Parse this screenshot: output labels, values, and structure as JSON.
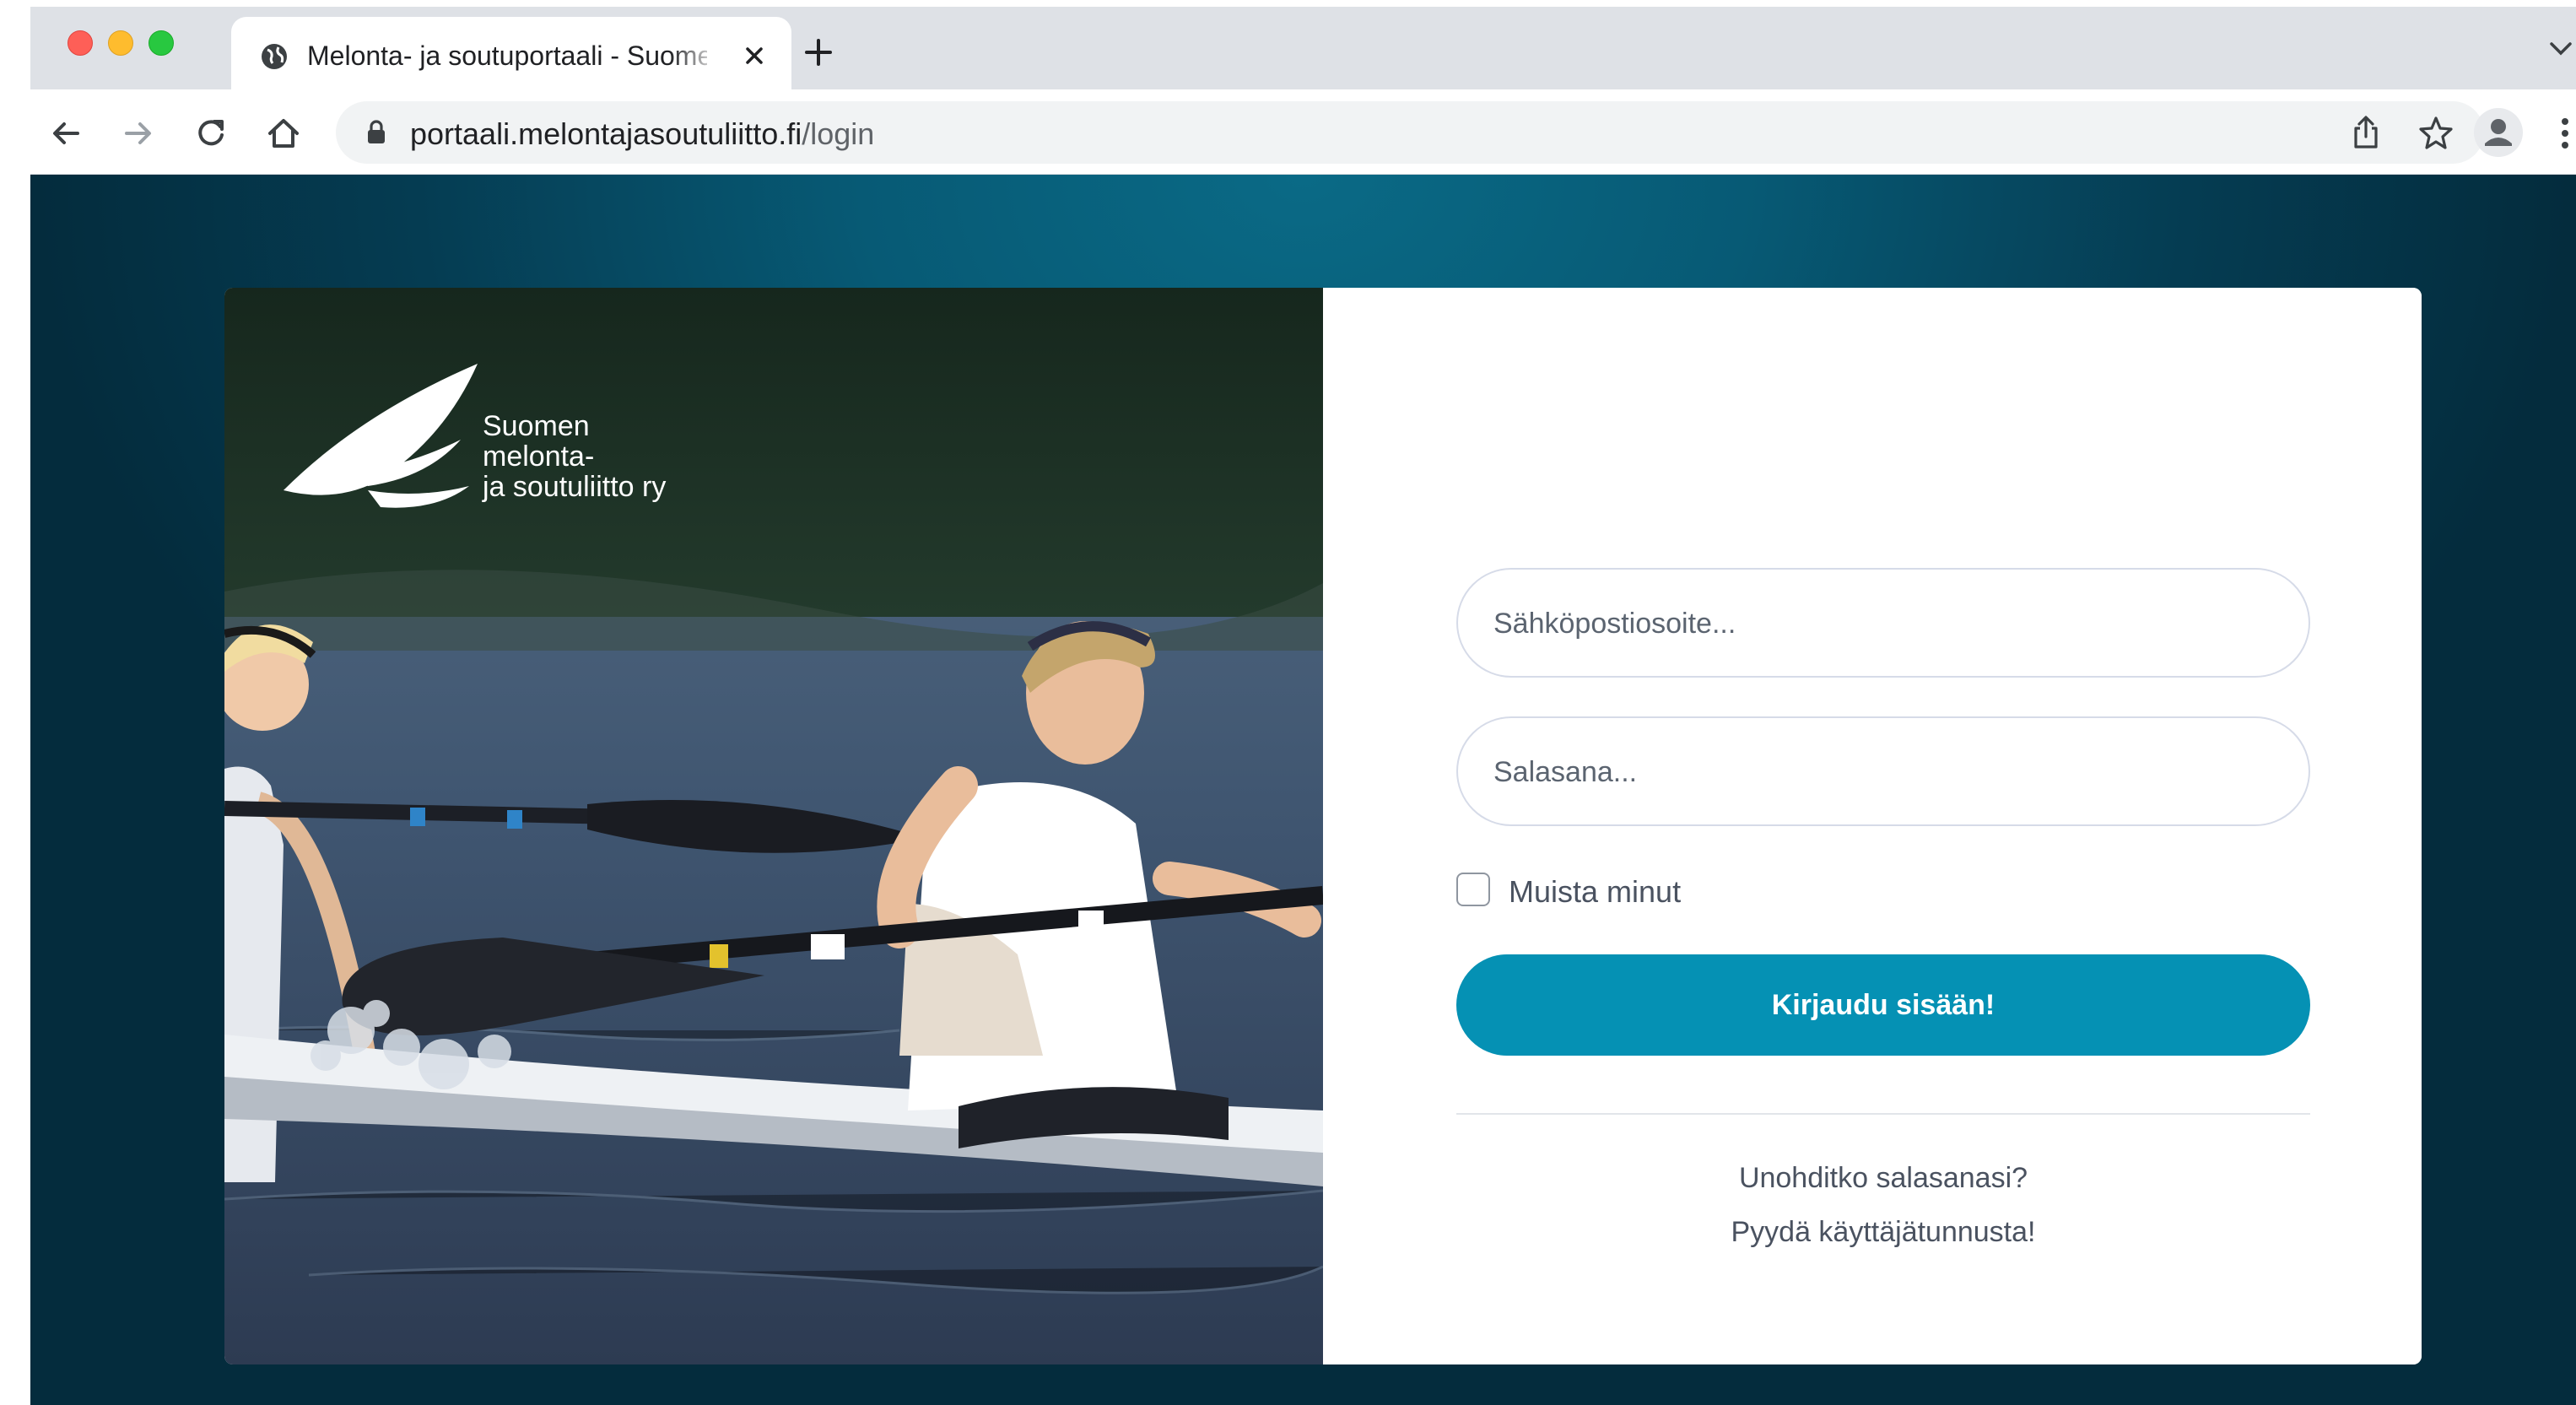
{
  "browser": {
    "tab": {
      "title": "Melonta- ja soutuportaali - Suomen melonta- ja soutuliitto"
    },
    "url": {
      "host": "portaali.melontajasoutuliitto.fi",
      "path": "/login"
    }
  },
  "brand": {
    "logo_lines": [
      "Suomen",
      "melonta-",
      "ja soutuliitto ry"
    ]
  },
  "form": {
    "email_placeholder": "Sähköpostiosoite...",
    "password_placeholder": "Salasana...",
    "remember_label": "Muista minut",
    "remember_checked": false,
    "submit_label": "Kirjaudu sisään!",
    "forgot_link": "Unohditko salasanasi?",
    "request_link": "Pyydä käyttäjätunnusta!"
  },
  "colors": {
    "accent": "#0591b4",
    "page_background": "#075a75"
  }
}
